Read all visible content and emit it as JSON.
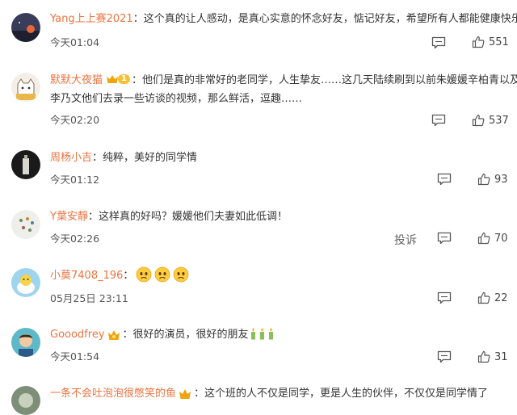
{
  "comments": [
    {
      "user": "Yang上上赛2021",
      "text": "：这个真的让人感动，是真心实意的怀念好友，惦记好友，希望所有人都能健康快乐",
      "time": "今天01:04",
      "likes": "551"
    },
    {
      "user": "默默大夜猫",
      "badge_level": "1",
      "text_line1": "：他们是真的非常好的老同学，人生挚友……这几天陆续刷到以前朱媛媛辛柏青以及",
      "text_line2": "李乃文他们去录一些访谈的视频，那么鲜活，逗趣……",
      "time": "今天02:20",
      "likes": "537"
    },
    {
      "user": "周杨小吉",
      "text": "：纯粹，美好的同学情",
      "time": "今天01:12",
      "likes": "93"
    },
    {
      "user": "Y葉安靜",
      "text": "：这样真的好吗？媛媛他们夫妻如此低调！",
      "time": "今天02:26",
      "report": "投诉",
      "likes": "70"
    },
    {
      "user": "小莫7408_196",
      "text": "：",
      "emojis": [
        "sad-face-emoji",
        "sad-face-emoji",
        "sad-face-emoji"
      ],
      "time": "05月25日 23:11",
      "likes": "22"
    },
    {
      "user": "Gooodfrey",
      "text": "：很好的演员，很好的朋友",
      "emojis": [
        "candle-emoji",
        "candle-emoji",
        "candle-emoji"
      ],
      "time": "今天01:54",
      "likes": "31"
    },
    {
      "user": "一条不会吐泡泡很憋笑的鱼",
      "text": "：这个班的人不仅是同学，更是人生的伙伴，不仅仅是同学情了",
      "partial": true
    }
  ],
  "colors": {
    "username": "#eb7340",
    "text": "#333333",
    "meta": "#555555",
    "badge": "#f7c030"
  },
  "icons": {
    "reply": "comment-icon",
    "like": "thumbs-up-icon",
    "vip": "crown-icon"
  }
}
